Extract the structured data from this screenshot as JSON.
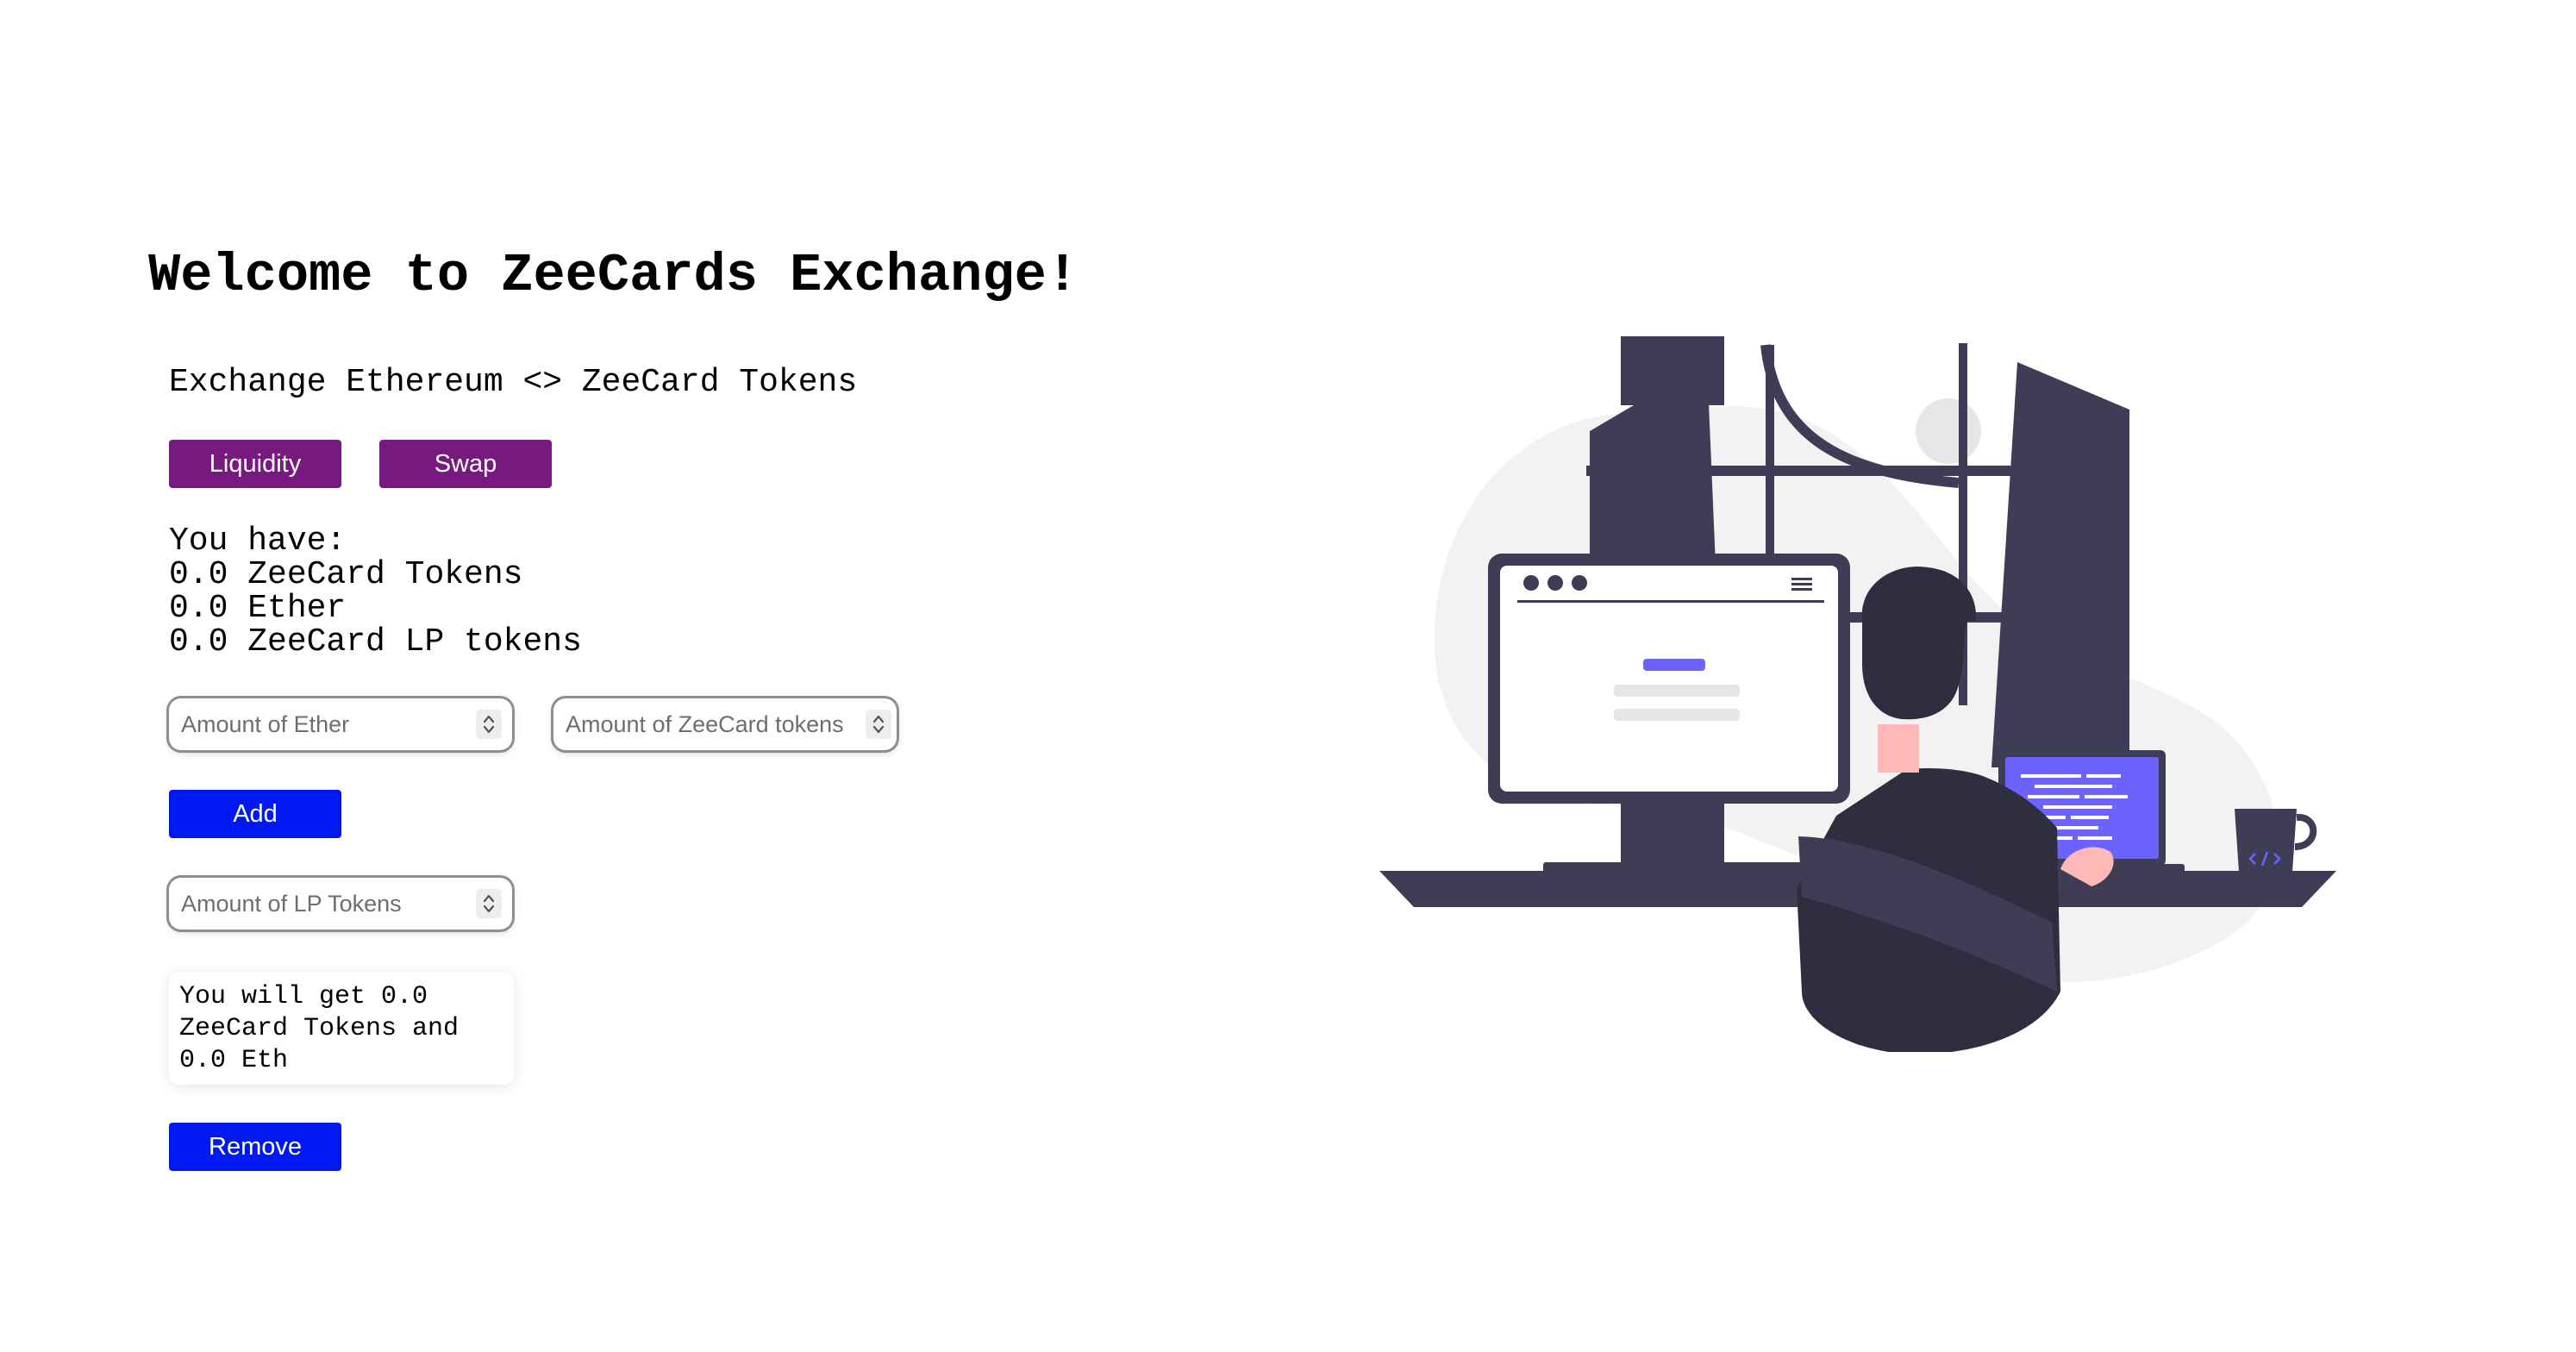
{
  "header": {
    "title": "Welcome to ZeeCards Exchange!",
    "subtitle": "Exchange Ethereum <> ZeeCard Tokens"
  },
  "tabs": [
    {
      "label": "Liquidity"
    },
    {
      "label": "Swap"
    }
  ],
  "balances": {
    "intro": "You have:",
    "lines": [
      "0.0 ZeeCard Tokens",
      "0.0 Ether",
      "0.0 ZeeCard LP tokens"
    ]
  },
  "add_liquidity": {
    "ether_placeholder": "Amount of Ether",
    "tokens_placeholder": "Amount of ZeeCard tokens",
    "add_label": "Add"
  },
  "remove_liquidity": {
    "lp_placeholder": "Amount of LP Tokens",
    "estimate_lines": [
      "You will get 0.0",
      "ZeeCard Tokens and",
      "0.0 Eth"
    ],
    "remove_label": "Remove"
  },
  "colors": {
    "tab_button": "#77197f",
    "action_button": "#0019f2",
    "illustration_dark": "#3f3d56",
    "illustration_accent": "#6c63ff"
  }
}
